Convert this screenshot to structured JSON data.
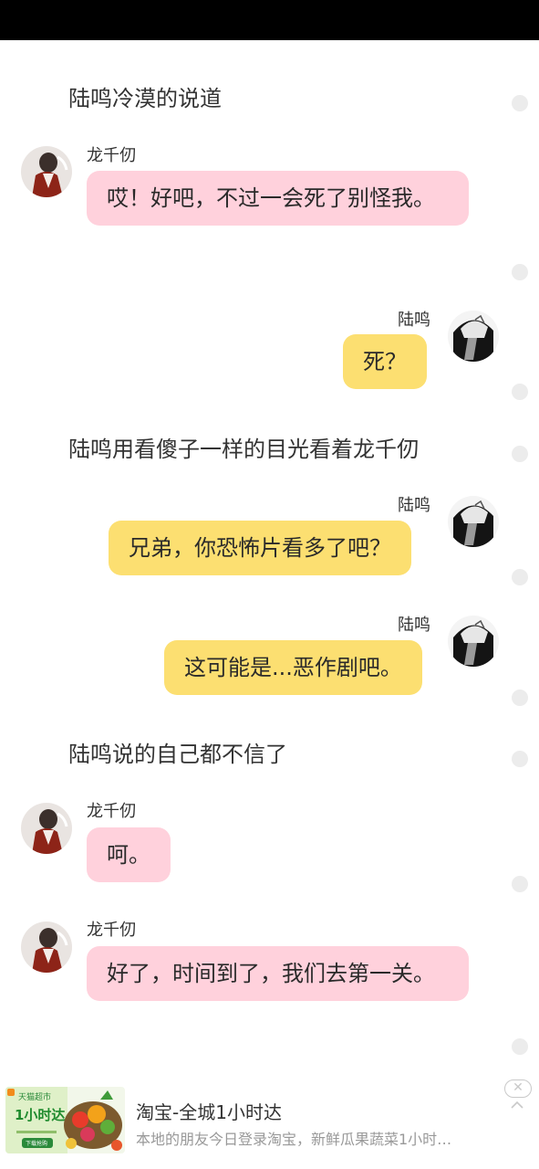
{
  "status_bar": {},
  "chat": {
    "narrations": [
      "陆鸣冷漠的说道",
      "陆鸣用看傻子一样的目光看着龙千仞",
      "陆鸣说的自己都不信了"
    ],
    "speakers": {
      "left": "龙千仞",
      "right": "陆鸣"
    },
    "messages": [
      {
        "speaker": "龙千仞",
        "text": "哎！好吧，不过一会死了别怪我。"
      },
      {
        "speaker": "陆鸣",
        "text": "死？"
      },
      {
        "speaker": "陆鸣",
        "text": "兄弟，你恐怖片看多了吧？"
      },
      {
        "speaker": "陆鸣",
        "text": "这可能是...恶作剧吧。"
      },
      {
        "speaker": "龙千仞",
        "text": "呵。"
      },
      {
        "speaker": "龙千仞",
        "text": "好了，时间到了，我们去第一关。"
      }
    ],
    "bubble_colors": {
      "left": "#ffd1dc",
      "right": "#fcdf71"
    }
  },
  "ad": {
    "title": "淘宝-全城1小时达",
    "description": "本地的朋友今日登录淘宝，新鲜瓜果蔬菜1小时…",
    "thumb_brand": "天猫超市",
    "thumb_headline": "1小时达",
    "thumb_button": "下载抢购",
    "close_icon": "close-icon",
    "collapse_icon": "chevron-up-icon"
  }
}
